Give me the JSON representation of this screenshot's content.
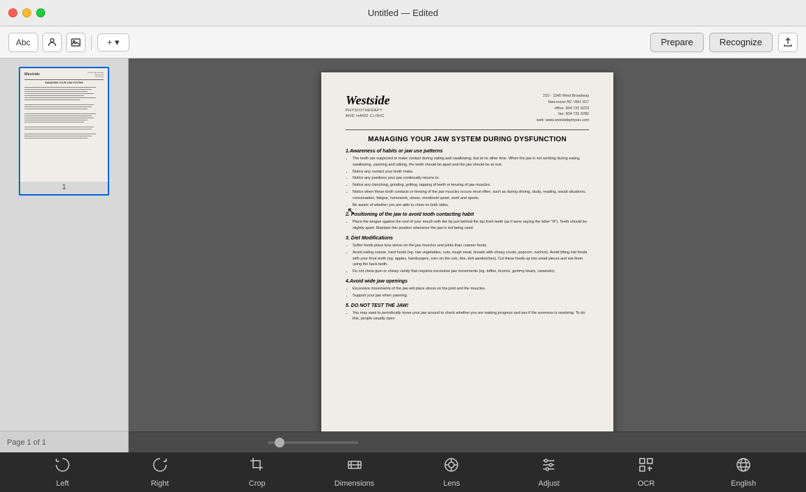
{
  "titlebar": {
    "title": "Untitled — Edited"
  },
  "toolbar": {
    "text_btn_label": "Abc",
    "prepare_label": "Prepare",
    "recognize_label": "Recognize",
    "add_btn_label": "+ ▾"
  },
  "sidebar": {
    "page_number": "1",
    "status": "Page 1 of 1"
  },
  "document": {
    "logo_text": "Westside",
    "logo_subtext": "PHYSIOTHERAPY\nAND HAND CLINIC",
    "address_line1": "210 - 1245 West Broadway",
    "address_line2": "Vancouver BC  V6H 1G7",
    "address_phone": "office: 604 731 6223",
    "address_fax": "fax: 604 731 6282",
    "address_web": "web: www.westsidephysio.com",
    "title": "MANAGING YOUR JAW SYSTEM DURING DYSFUNCTION",
    "section1_title": "1.Awareness of habits or jaw use patterns",
    "section1_bullet1": "The teeth are supposed to make contact during eating and swallowing, but at no other time. When the jaw is not working during eating, swallowing, yawning and talking, the teeth should be apart and the jaw should be at rest.",
    "section1_bullet2": "Notice any contact your teeth make.",
    "section1_bullet3": "Notice any positions your jaw continually returns to.",
    "section1_bullet4": "Notice any clenching, grinding, gritting, tapping of teeth or tensing of jaw muscles.",
    "section1_bullet5": "Notice when these tooth contacts or tensing of the jaw muscles occurs most often, such as during driving, study, reading, social situations, conversation, fatigue, homework, stress, emotional upset, work and sports.",
    "section1_bullet6": "Be aware of whether you are able to chew on both sides.",
    "section2_title": "2. Positioning of the jaw to avoid tooth contacting habit",
    "section2_bullet1": "Place the tongue against the roof of your mouth with the tip just behind the top front teeth (as if were saying the letter \"N\"). Teeth should be slightly apart. Maintain this position whenever the jaw is not being used.",
    "section3_title": "3. Diet Modifications",
    "section3_bullet1": "Softer foods place less stress on the jaw muscles and joints than coarser foods.",
    "section3_bullet2": "Avoid eating coarse, hard foods (eg. raw vegetables, nuts, tough meat, breads with chewy crusts, popcorn, nachos). Avoid biting into foods with your front teeth (eg. apples, hamburgers, corn on the cob, ribs, deli sandwiches). Cut these foods up into small pieces and eat them using the back teeth.",
    "section3_bullet3": "Do not chew gum or chewy candy that requires excessive jaw movements (eg. toffee, licorice, gummy bears, caramels).",
    "section4_title": "4.Avoid wide jaw openings",
    "section4_bullet1": "Excessive movements of the jaw will place stress on the joint and the muscles.",
    "section4_bullet2": "Support your jaw when yawning.",
    "section5_title": "5. DO NOT TEST THE JAW!",
    "section5_bullet1": "You may want to periodically move your jaw around to check whether you are making progress and see if the soreness is resolving. To do this, people usually open"
  },
  "bottom_toolbar": {
    "tools": [
      {
        "id": "left",
        "label": "Left",
        "icon": "rotate-left"
      },
      {
        "id": "right",
        "label": "Right",
        "icon": "rotate-right"
      },
      {
        "id": "crop",
        "label": "Crop",
        "icon": "crop"
      },
      {
        "id": "dimensions",
        "label": "Dimensions",
        "icon": "dimensions"
      },
      {
        "id": "lens",
        "label": "Lens",
        "icon": "lens"
      },
      {
        "id": "adjust",
        "label": "Adjust",
        "icon": "adjust"
      },
      {
        "id": "ocr",
        "label": "OCR",
        "icon": "ocr"
      },
      {
        "id": "english",
        "label": "English",
        "icon": "globe"
      }
    ]
  }
}
